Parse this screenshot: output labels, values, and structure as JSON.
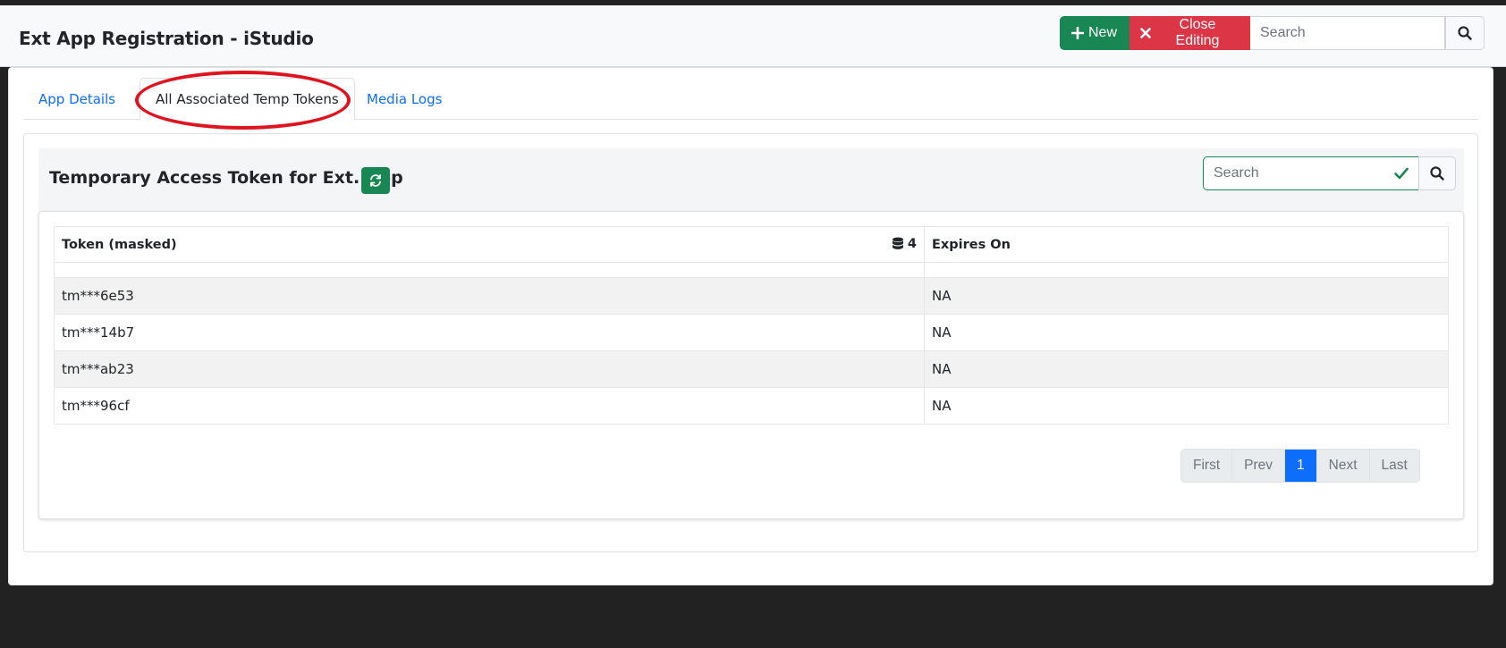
{
  "header": {
    "title": "Ext App Registration - iStudio",
    "new_label": "New",
    "close_label": "Close Editing",
    "search_placeholder": "Search"
  },
  "tabs": [
    {
      "label": "App Details",
      "active": false
    },
    {
      "label": "All Associated Temp Tokens",
      "active": true
    },
    {
      "label": "Media Logs",
      "active": false
    }
  ],
  "panel": {
    "title": "Temporary Access Token for Ext. App",
    "search_placeholder": "Search"
  },
  "table": {
    "columns": [
      "Token (masked)",
      "Expires On"
    ],
    "record_count": "4",
    "rows": [
      {
        "token": "tm***6e53",
        "expires": "NA"
      },
      {
        "token": "tm***14b7",
        "expires": "NA"
      },
      {
        "token": "tm***ab23",
        "expires": "NA"
      },
      {
        "token": "tm***96cf",
        "expires": "NA"
      }
    ]
  },
  "pagination": {
    "first": "First",
    "prev": "Prev",
    "current": "1",
    "next": "Next",
    "last": "Last"
  },
  "colors": {
    "success": "#198754",
    "danger": "#dc3545",
    "primary": "#0d6efd",
    "annotation": "#e0141e"
  }
}
